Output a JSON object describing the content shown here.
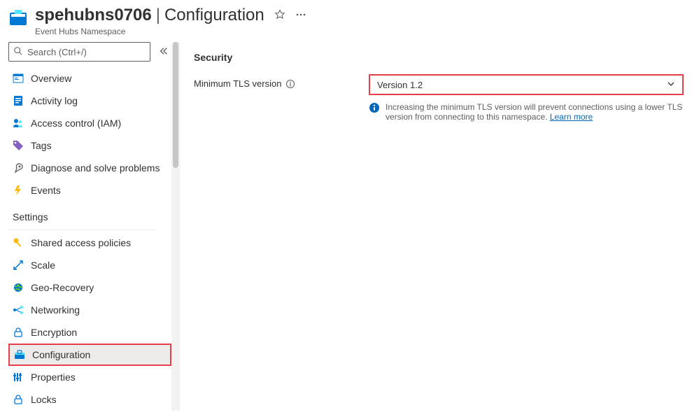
{
  "header": {
    "resource_name": "spehubns0706",
    "page_name": "Configuration",
    "resource_type": "Event Hubs Namespace"
  },
  "search": {
    "placeholder": "Search (Ctrl+/)"
  },
  "nav": {
    "overview": "Overview",
    "activity_log": "Activity log",
    "access_control": "Access control (IAM)",
    "tags": "Tags",
    "diagnose": "Diagnose and solve problems",
    "events": "Events"
  },
  "settings_section": {
    "label": "Settings",
    "shared_access": "Shared access policies",
    "scale": "Scale",
    "geo_recovery": "Geo-Recovery",
    "networking": "Networking",
    "encryption": "Encryption",
    "configuration": "Configuration",
    "properties": "Properties",
    "locks": "Locks"
  },
  "main": {
    "security_heading": "Security",
    "tls_label": "Minimum TLS version",
    "tls_value": "Version 1.2",
    "tls_info": "Increasing the minimum TLS version will prevent connections using a lower TLS version from connecting to this namespace. ",
    "learn_more": "Learn more"
  }
}
